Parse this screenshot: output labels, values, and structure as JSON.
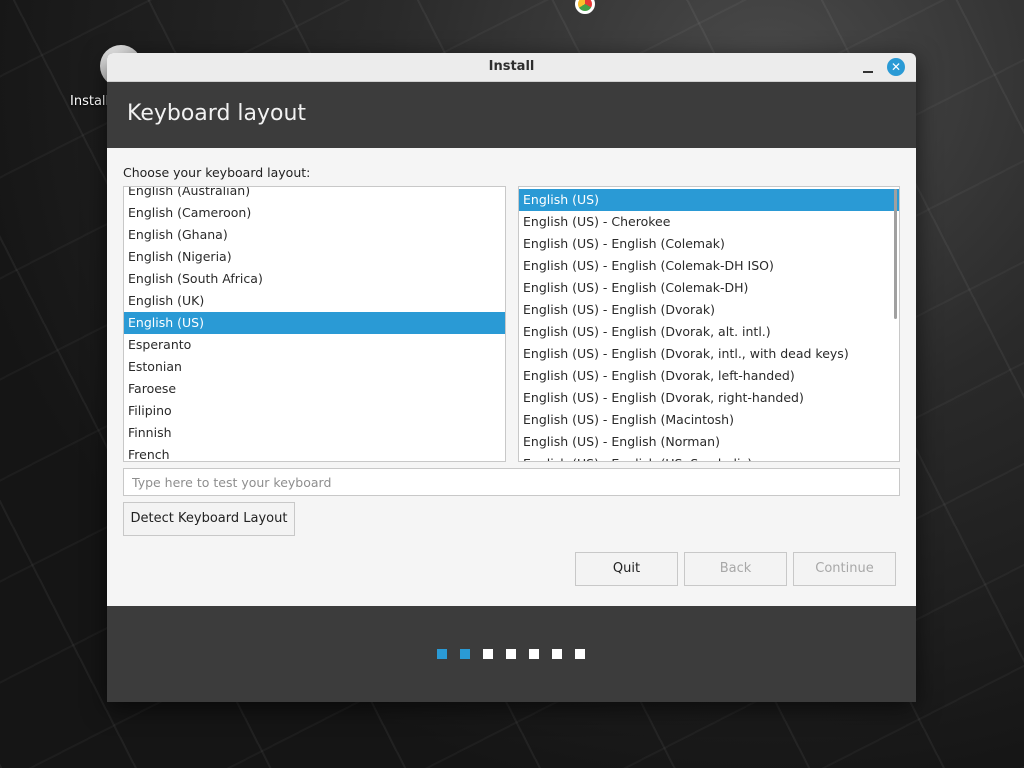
{
  "desktop": {
    "install_icon_label": "Install"
  },
  "window": {
    "title": "Install",
    "close_glyph": "✕"
  },
  "header": {
    "title": "Keyboard layout"
  },
  "content": {
    "choose_label": "Choose your keyboard layout:",
    "layouts": [
      {
        "label": "English (Australian)",
        "selected": false
      },
      {
        "label": "English (Cameroon)",
        "selected": false
      },
      {
        "label": "English (Ghana)",
        "selected": false
      },
      {
        "label": "English (Nigeria)",
        "selected": false
      },
      {
        "label": "English (South Africa)",
        "selected": false
      },
      {
        "label": "English (UK)",
        "selected": false
      },
      {
        "label": "English (US)",
        "selected": true
      },
      {
        "label": "Esperanto",
        "selected": false
      },
      {
        "label": "Estonian",
        "selected": false
      },
      {
        "label": "Faroese",
        "selected": false
      },
      {
        "label": "Filipino",
        "selected": false
      },
      {
        "label": "Finnish",
        "selected": false
      },
      {
        "label": "French",
        "selected": false
      }
    ],
    "variants": [
      {
        "label": "English (US)",
        "selected": true
      },
      {
        "label": "English (US) - Cherokee",
        "selected": false
      },
      {
        "label": "English (US) - English (Colemak)",
        "selected": false
      },
      {
        "label": "English (US) - English (Colemak-DH ISO)",
        "selected": false
      },
      {
        "label": "English (US) - English (Colemak-DH)",
        "selected": false
      },
      {
        "label": "English (US) - English (Dvorak)",
        "selected": false
      },
      {
        "label": "English (US) - English (Dvorak, alt. intl.)",
        "selected": false
      },
      {
        "label": "English (US) - English (Dvorak, intl., with dead keys)",
        "selected": false
      },
      {
        "label": "English (US) - English (Dvorak, left-handed)",
        "selected": false
      },
      {
        "label": "English (US) - English (Dvorak, right-handed)",
        "selected": false
      },
      {
        "label": "English (US) - English (Macintosh)",
        "selected": false
      },
      {
        "label": "English (US) - English (Norman)",
        "selected": false
      },
      {
        "label": "English (US) - English (US, Symbolic)",
        "selected": false
      }
    ],
    "test_placeholder": "Type here to test your keyboard",
    "test_value": "",
    "detect_button": "Detect Keyboard Layout"
  },
  "buttons": {
    "quit": "Quit",
    "back": "Back",
    "continue": "Continue"
  },
  "progress": {
    "total_steps": 7,
    "completed_steps": 2
  },
  "colors": {
    "accent": "#2a9ad5",
    "header_bg": "#3c3c3c",
    "content_bg": "#f5f5f5"
  }
}
